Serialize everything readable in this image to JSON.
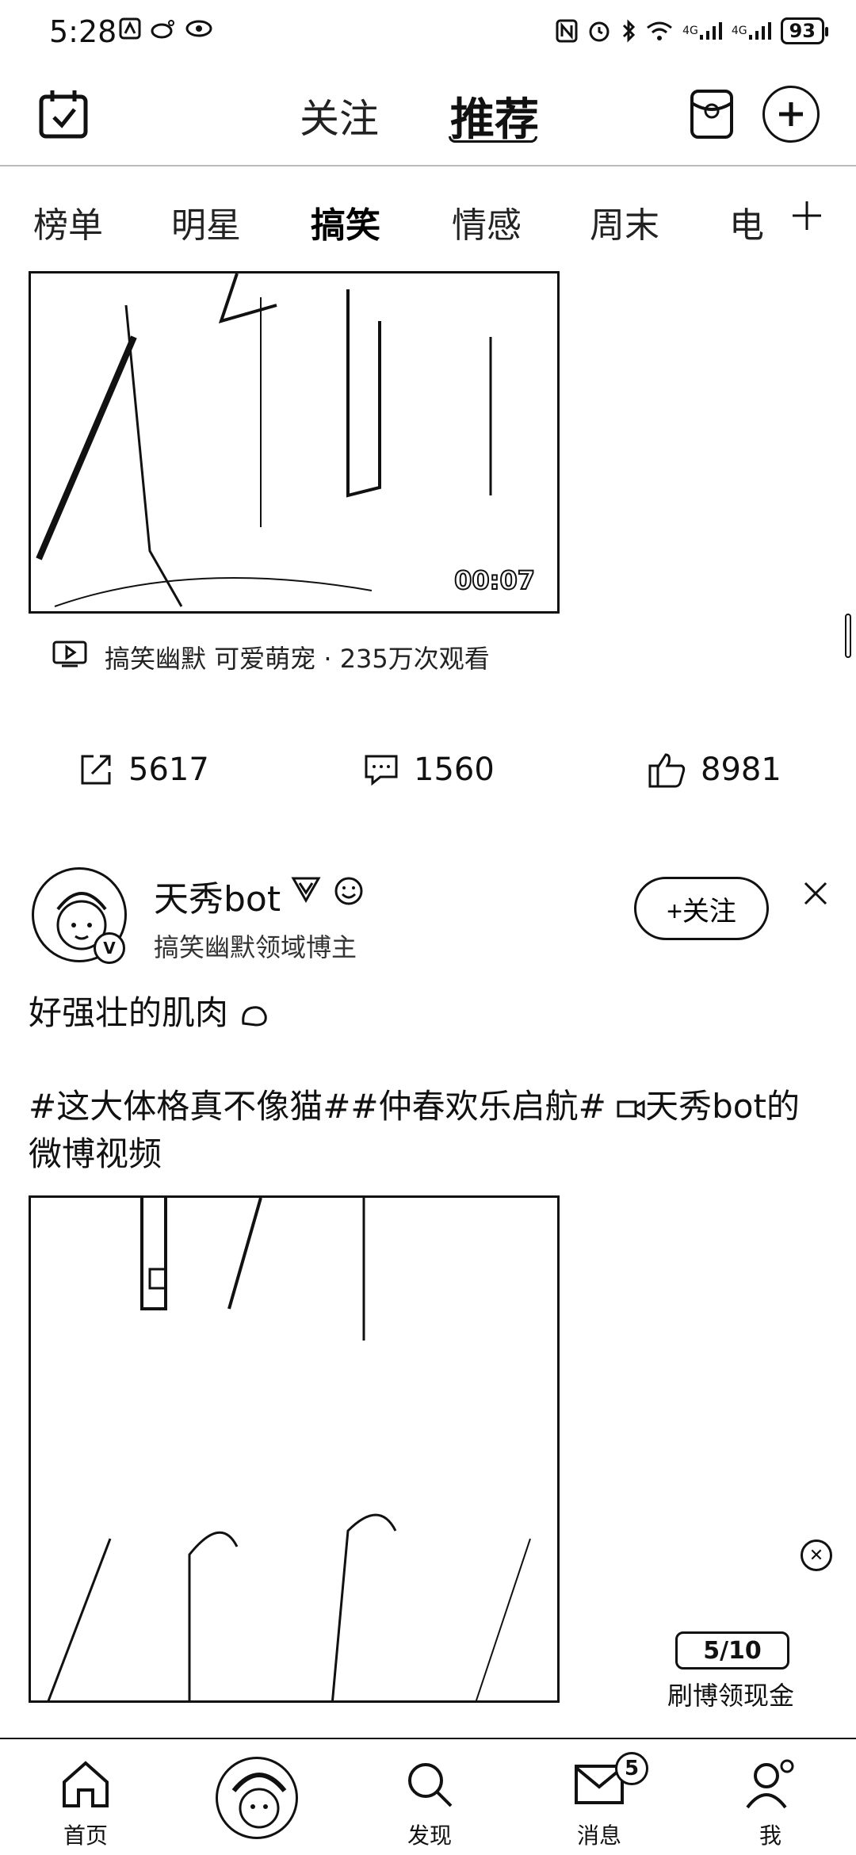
{
  "status_bar": {
    "time": "5:28",
    "network": "4G",
    "battery": "93"
  },
  "top_nav": {
    "tab_follow": "关注",
    "tab_recommend": "推荐"
  },
  "channels": [
    "榜单",
    "明星",
    "搞笑",
    "情感",
    "周末",
    "电"
  ],
  "post1": {
    "duration": "00:07",
    "meta": "搞笑幽默 可爱萌宠 · 235万次观看",
    "shares": "5617",
    "comments": "1560",
    "likes": "8981"
  },
  "post2": {
    "user_name": "天秀bot",
    "user_desc": "搞笑幽默领域博主",
    "follow_label": "+关注",
    "text": "好强壮的肌肉",
    "tags_line": "#这大体格真不像猫##仲春欢乐启航# ",
    "tags_suffix": "天秀bot的微博视频"
  },
  "reward": {
    "progress": "5/10",
    "label": "刷博领现金"
  },
  "bottom_nav": {
    "home": "首页",
    "discover": "发现",
    "messages": "消息",
    "messages_badge": "5",
    "me": "我"
  }
}
